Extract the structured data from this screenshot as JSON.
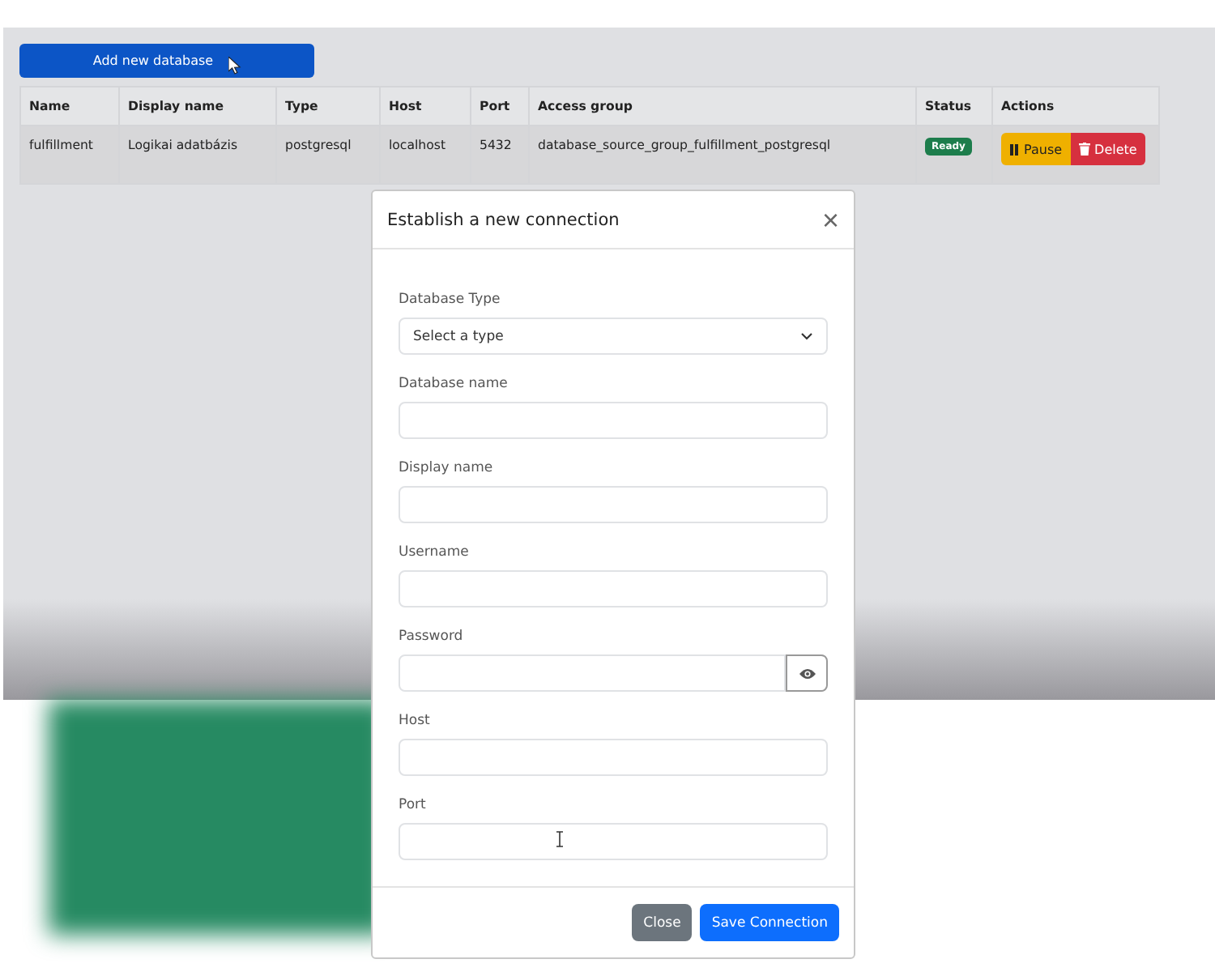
{
  "toolbar": {
    "add_button": "Add new database"
  },
  "table": {
    "columns": [
      "Name",
      "Display name",
      "Type",
      "Host",
      "Port",
      "Access group",
      "Status",
      "Actions"
    ],
    "rows": [
      {
        "name": "fulfillment",
        "display_name": "Logikai adatbázis",
        "type": "postgresql",
        "host": "localhost",
        "port": "5432",
        "access_group": "database_source_group_fulfillment_postgresql",
        "status": "Ready",
        "actions": [
          {
            "kind": "pause",
            "label": "Pause"
          },
          {
            "kind": "delete",
            "label": "Delete"
          }
        ]
      }
    ]
  },
  "modal": {
    "title": "Establish a new connection",
    "close_glyph": "×",
    "fields": [
      {
        "kind": "select",
        "label": "Database Type",
        "value": "Select a type"
      },
      {
        "kind": "text",
        "label": "Database name"
      },
      {
        "kind": "text",
        "label": "Display name"
      },
      {
        "kind": "text",
        "label": "Username"
      },
      {
        "kind": "password",
        "label": "Password"
      },
      {
        "kind": "text",
        "label": "Host"
      },
      {
        "kind": "text",
        "label": "Port"
      }
    ],
    "buttons": [
      {
        "kind": "secondary",
        "label": "Close"
      },
      {
        "kind": "primary",
        "label": "Save Connection"
      }
    ]
  }
}
